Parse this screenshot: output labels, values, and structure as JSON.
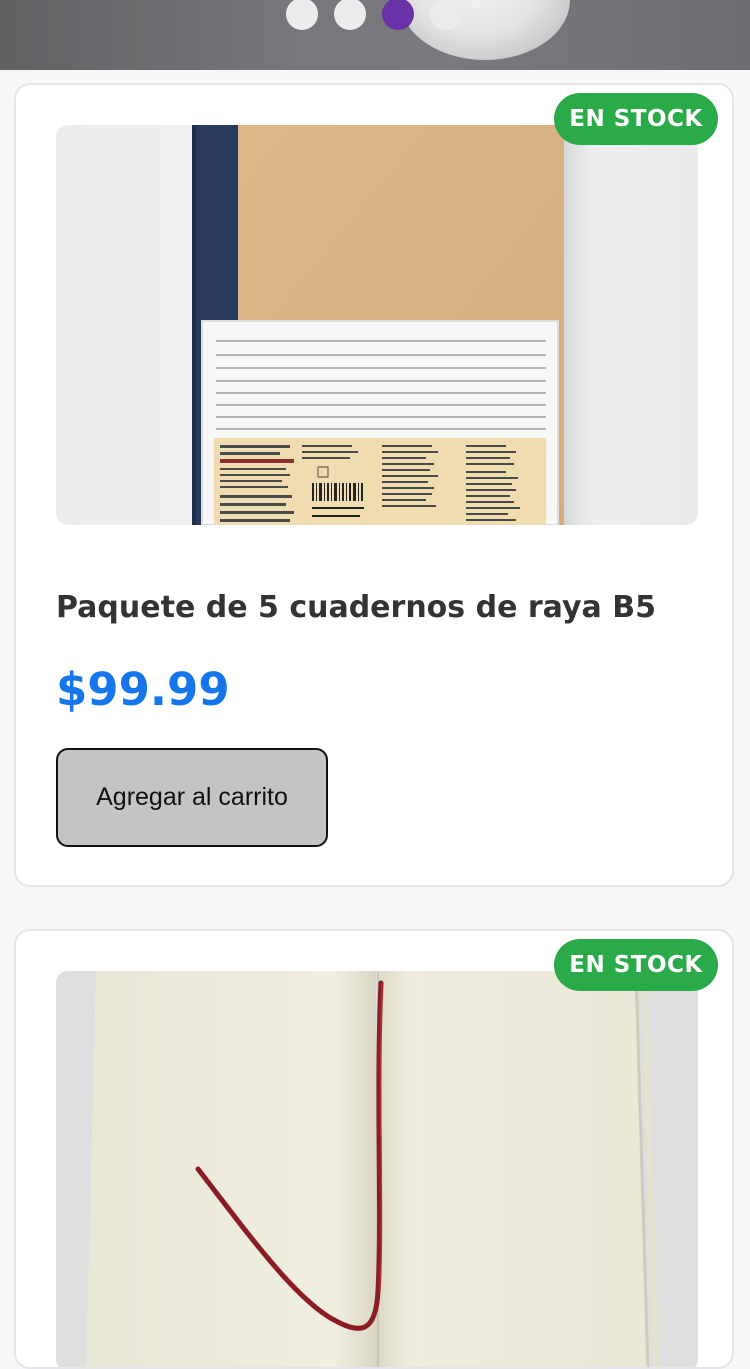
{
  "carousel": {
    "dots": [
      {
        "active": false
      },
      {
        "active": false
      },
      {
        "active": true
      },
      {
        "active": false
      }
    ]
  },
  "products": [
    {
      "badge": "EN STOCK",
      "title": "Paquete de 5 cuadernos de raya B5",
      "price": "$99.99",
      "button_label": "Agregar al carrito",
      "image": "notebook-kraft-cover-photo"
    },
    {
      "badge": "EN STOCK",
      "image": "open-notebook-ribbon-photo"
    }
  ],
  "colors": {
    "badge": "#2aaa48",
    "price": "#1476ea",
    "dot_active": "#6a32a8",
    "dot_inactive": "#ececee",
    "button": "#c4c4c4"
  }
}
